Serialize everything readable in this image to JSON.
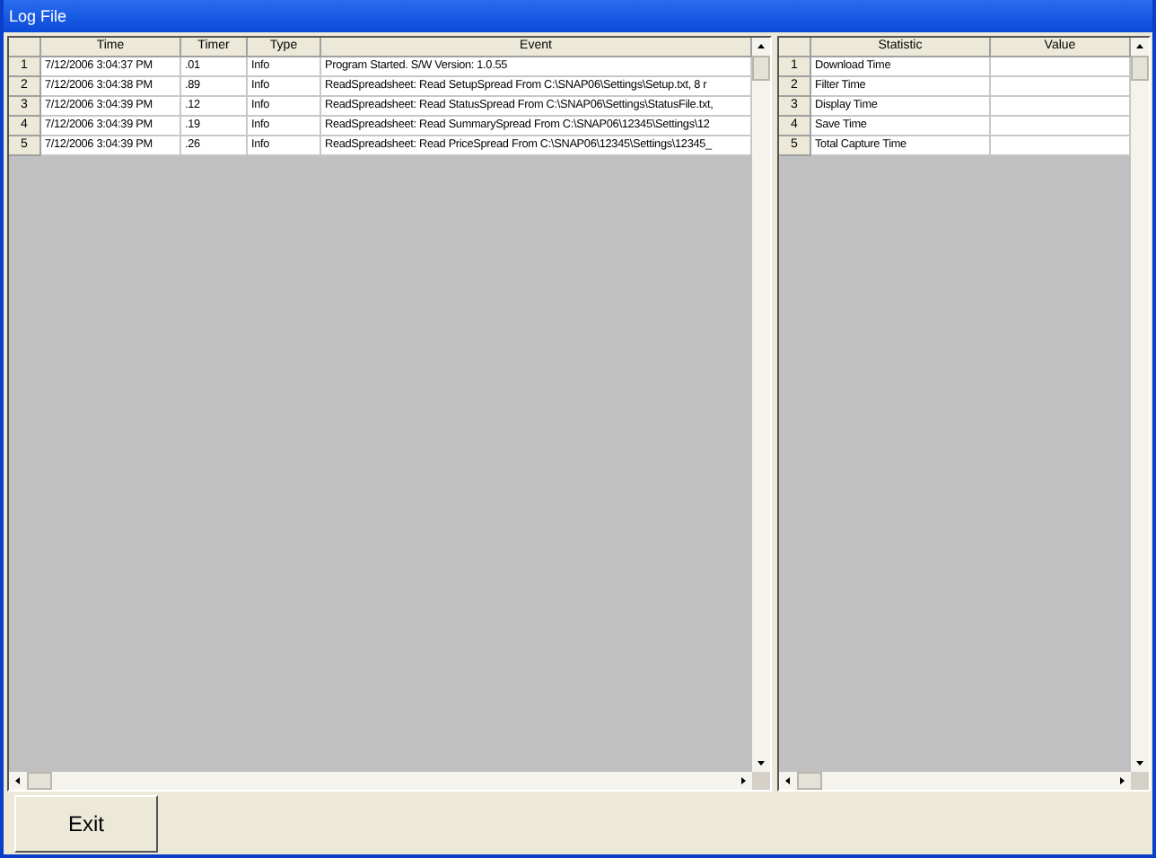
{
  "window": {
    "title": "Log File"
  },
  "log_table": {
    "columns": [
      "Time",
      "Timer",
      "Type",
      "Event"
    ],
    "rows": [
      {
        "index": "1",
        "cells": [
          "7/12/2006 3:04:37 PM",
          ".01",
          "Info",
          "Program Started. S/W Version: 1.0.55"
        ]
      },
      {
        "index": "2",
        "cells": [
          "7/12/2006 3:04:38 PM",
          ".89",
          "Info",
          "ReadSpreadsheet: Read SetupSpread From C:\\SNAP06\\Settings\\Setup.txt, 8 r"
        ]
      },
      {
        "index": "3",
        "cells": [
          "7/12/2006 3:04:39 PM",
          ".12",
          "Info",
          "ReadSpreadsheet: Read StatusSpread From C:\\SNAP06\\Settings\\StatusFile.txt,"
        ]
      },
      {
        "index": "4",
        "cells": [
          "7/12/2006 3:04:39 PM",
          ".19",
          "Info",
          "ReadSpreadsheet: Read SummarySpread From C:\\SNAP06\\12345\\Settings\\12"
        ]
      },
      {
        "index": "5",
        "cells": [
          "7/12/2006 3:04:39 PM",
          ".26",
          "Info",
          "ReadSpreadsheet: Read PriceSpread From C:\\SNAP06\\12345\\Settings\\12345_"
        ]
      }
    ]
  },
  "stats_table": {
    "columns": [
      "Statistic",
      "Value"
    ],
    "rows": [
      {
        "index": "1",
        "cells": [
          "Download Time",
          ""
        ]
      },
      {
        "index": "2",
        "cells": [
          "Filter Time",
          ""
        ]
      },
      {
        "index": "3",
        "cells": [
          "Display Time",
          ""
        ]
      },
      {
        "index": "4",
        "cells": [
          "Save Time",
          ""
        ]
      },
      {
        "index": "5",
        "cells": [
          "Total Capture Time",
          ""
        ]
      }
    ]
  },
  "buttons": [
    "Exit"
  ]
}
